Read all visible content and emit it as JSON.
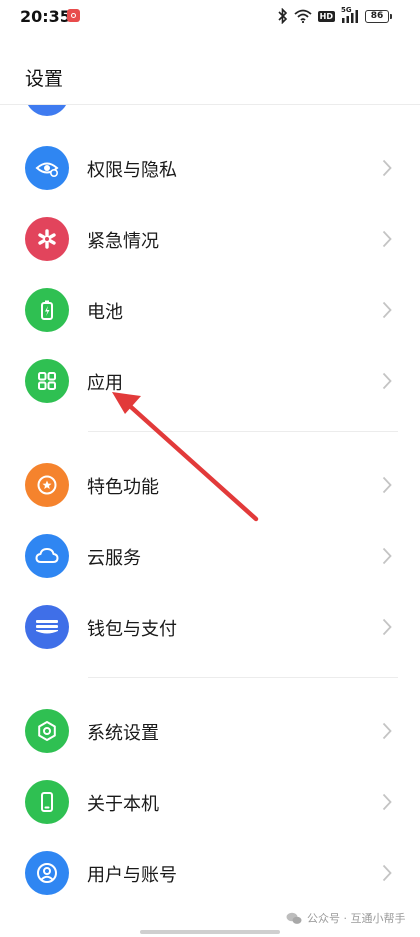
{
  "status_bar": {
    "time": "20:35",
    "network_label": "5G",
    "hd_label": "HD",
    "battery": "86",
    "icons": [
      "notification-icon",
      "bluetooth-icon",
      "wifi-icon",
      "signal-icon",
      "battery-icon"
    ]
  },
  "header": {
    "title": "设置"
  },
  "settings": {
    "items": [
      {
        "label": "权限与隐私",
        "icon": "privacy-eye-icon",
        "color": "#2f86f2"
      },
      {
        "label": "紧急情况",
        "icon": "emergency-asterisk-icon",
        "color": "#e2445c"
      },
      {
        "label": "电池",
        "icon": "battery-icon",
        "color": "#2fc052"
      },
      {
        "label": "应用",
        "icon": "apps-grid-icon",
        "color": "#2fc052"
      },
      {
        "label": "特色功能",
        "icon": "star-icon",
        "color": "#f5832d"
      },
      {
        "label": "云服务",
        "icon": "cloud-icon",
        "color": "#2f86f2"
      },
      {
        "label": "钱包与支付",
        "icon": "wallet-icon",
        "color": "#3f6fe8"
      },
      {
        "label": "系统设置",
        "icon": "system-gear-icon",
        "color": "#2fc052"
      },
      {
        "label": "关于本机",
        "icon": "phone-icon",
        "color": "#2fc052"
      },
      {
        "label": "用户与账号",
        "icon": "user-icon",
        "color": "#2f86f2"
      }
    ]
  },
  "annotation": {
    "color": "#e23a3a",
    "points_to": "应用"
  },
  "watermark": {
    "text": "公众号 · 互通小帮手",
    "icon": "wechat-icon"
  }
}
